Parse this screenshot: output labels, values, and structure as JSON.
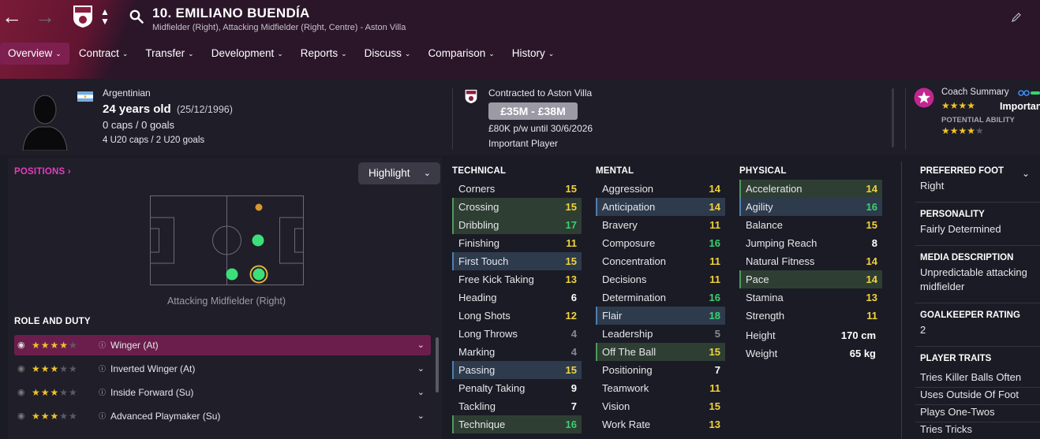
{
  "header": {
    "title": "10. EMILIANO BUENDÍA",
    "subtitle": "Midfielder (Right), Attacking Midfielder (Right, Centre) - Aston Villa",
    "tabs": [
      {
        "label": "Overview"
      },
      {
        "label": "Contract"
      },
      {
        "label": "Transfer"
      },
      {
        "label": "Development"
      },
      {
        "label": "Reports"
      },
      {
        "label": "Discuss"
      },
      {
        "label": "Comparison"
      },
      {
        "label": "History"
      }
    ],
    "colors": {
      "accent": "#7d2050",
      "bar": "#2a1529"
    }
  },
  "bio": {
    "nationality": "Argentinian",
    "age": "24 years old",
    "dob": "(25/12/1996)",
    "caps": "0 caps / 0 goals",
    "u20": "4 U20 caps / 2 U20 goals"
  },
  "contract": {
    "club": "Contracted to Aston Villa",
    "value": "£35M - £38M",
    "wage": "£80K p/w until 30/6/2026",
    "status": "Important Player"
  },
  "coach": {
    "title": "Coach Summary",
    "current_stars": 3.5,
    "role_text": "Importan",
    "potential_label": "POTENTIAL ABILITY",
    "potential_stars": 4
  },
  "positions": {
    "title": "POSITIONS",
    "highlight_label": "Highlight",
    "caption": "Attacking Midfielder (Right)"
  },
  "roles": {
    "title": "ROLE AND DUTY",
    "items": [
      {
        "label": "Winger (At)",
        "stars": 3.5,
        "selected": true
      },
      {
        "label": "Inverted Winger (At)",
        "stars": 3,
        "selected": false
      },
      {
        "label": "Inside Forward (Su)",
        "stars": 3,
        "selected": false
      },
      {
        "label": "Advanced Playmaker (Su)",
        "stars": 3,
        "selected": false
      }
    ]
  },
  "technical": {
    "title": "TECHNICAL",
    "items": [
      {
        "name": "Corners",
        "value": "15",
        "hl": ""
      },
      {
        "name": "Crossing",
        "value": "15",
        "hl": "g"
      },
      {
        "name": "Dribbling",
        "value": "17",
        "hl": "g"
      },
      {
        "name": "Finishing",
        "value": "11",
        "hl": ""
      },
      {
        "name": "First Touch",
        "value": "15",
        "hl": "b"
      },
      {
        "name": "Free Kick Taking",
        "value": "13",
        "hl": ""
      },
      {
        "name": "Heading",
        "value": "6",
        "hl": ""
      },
      {
        "name": "Long Shots",
        "value": "12",
        "hl": ""
      },
      {
        "name": "Long Throws",
        "value": "4",
        "hl": ""
      },
      {
        "name": "Marking",
        "value": "4",
        "hl": ""
      },
      {
        "name": "Passing",
        "value": "15",
        "hl": "b"
      },
      {
        "name": "Penalty Taking",
        "value": "9",
        "hl": ""
      },
      {
        "name": "Tackling",
        "value": "7",
        "hl": ""
      },
      {
        "name": "Technique",
        "value": "16",
        "hl": "g"
      }
    ]
  },
  "mental": {
    "title": "MENTAL",
    "items": [
      {
        "name": "Aggression",
        "value": "14",
        "hl": ""
      },
      {
        "name": "Anticipation",
        "value": "14",
        "hl": "b"
      },
      {
        "name": "Bravery",
        "value": "11",
        "hl": ""
      },
      {
        "name": "Composure",
        "value": "16",
        "hl": ""
      },
      {
        "name": "Concentration",
        "value": "11",
        "hl": ""
      },
      {
        "name": "Decisions",
        "value": "11",
        "hl": ""
      },
      {
        "name": "Determination",
        "value": "16",
        "hl": ""
      },
      {
        "name": "Flair",
        "value": "18",
        "hl": "b"
      },
      {
        "name": "Leadership",
        "value": "5",
        "hl": ""
      },
      {
        "name": "Off The Ball",
        "value": "15",
        "hl": "g"
      },
      {
        "name": "Positioning",
        "value": "7",
        "hl": ""
      },
      {
        "name": "Teamwork",
        "value": "11",
        "hl": ""
      },
      {
        "name": "Vision",
        "value": "15",
        "hl": ""
      },
      {
        "name": "Work Rate",
        "value": "13",
        "hl": ""
      }
    ]
  },
  "physical": {
    "title": "PHYSICAL",
    "items": [
      {
        "name": "Acceleration",
        "value": "14",
        "hl": "g"
      },
      {
        "name": "Agility",
        "value": "16",
        "hl": "b"
      },
      {
        "name": "Balance",
        "value": "15",
        "hl": ""
      },
      {
        "name": "Jumping Reach",
        "value": "8",
        "hl": ""
      },
      {
        "name": "Natural Fitness",
        "value": "14",
        "hl": ""
      },
      {
        "name": "Pace",
        "value": "14",
        "hl": "g"
      },
      {
        "name": "Stamina",
        "value": "13",
        "hl": ""
      },
      {
        "name": "Strength",
        "value": "11",
        "hl": ""
      }
    ],
    "height_label": "Height",
    "height": "170 cm",
    "weight_label": "Weight",
    "weight": "65 kg"
  },
  "profile": {
    "foot_label": "PREFERRED FOOT",
    "foot": "Right",
    "personality_label": "PERSONALITY",
    "personality": "Fairly Determined",
    "media_label": "MEDIA DESCRIPTION",
    "media": "Unpredictable attacking midfielder",
    "gk_label": "GOALKEEPER RATING",
    "gk": "2",
    "traits_label": "PLAYER TRAITS",
    "traits": [
      "Tries Killer Balls Often",
      "Uses Outside Of Foot",
      "Plays One-Twos",
      "Tries Tricks"
    ]
  }
}
